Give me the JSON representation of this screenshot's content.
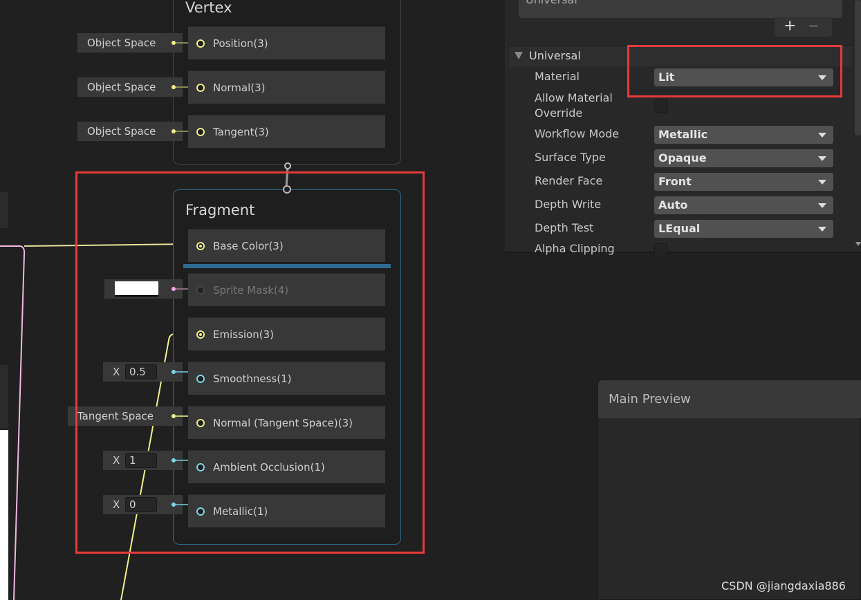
{
  "vertex": {
    "title": "Vertex",
    "ports": [
      {
        "label": "Position(3)",
        "input": "Object Space"
      },
      {
        "label": "Normal(3)",
        "input": "Object Space"
      },
      {
        "label": "Tangent(3)",
        "input": "Object Space"
      }
    ]
  },
  "fragment": {
    "title": "Fragment",
    "ports": [
      {
        "label": "Base Color(3)"
      },
      {
        "label": "Sprite Mask(4)"
      },
      {
        "label": "Emission(3)"
      },
      {
        "label": "Smoothness(1)",
        "axis": "X",
        "value": "0.5"
      },
      {
        "label": "Normal (Tangent Space)(3)",
        "input": "Tangent Space"
      },
      {
        "label": "Ambient Occlusion(1)",
        "axis": "X",
        "value": "1"
      },
      {
        "label": "Metallic(1)",
        "axis": "X",
        "value": "0"
      }
    ]
  },
  "inspector": {
    "target_list_item": "Universal",
    "add_label": "+",
    "remove_label": "−",
    "section_title": "Universal",
    "properties": [
      {
        "label": "Material",
        "value": "Lit"
      },
      {
        "label": "Allow Material Override",
        "checked": false
      },
      {
        "label": "Workflow Mode",
        "value": "Metallic"
      },
      {
        "label": "Surface Type",
        "value": "Opaque"
      },
      {
        "label": "Render Face",
        "value": "Front"
      },
      {
        "label": "Depth Write",
        "value": "Auto"
      },
      {
        "label": "Depth Test",
        "value": "LEqual"
      },
      {
        "label": "Alpha Clipping",
        "checked": false
      }
    ]
  },
  "preview": {
    "title": "Main Preview"
  },
  "watermark": "CSDN @jiangdaxia886",
  "colors": {
    "highlight": "#e8393a",
    "fragment_border": "#2d6a8f",
    "vector3_port": "#f3f08a",
    "float_port": "#7fd6e6",
    "vector4_port": "#f0a8e0"
  }
}
